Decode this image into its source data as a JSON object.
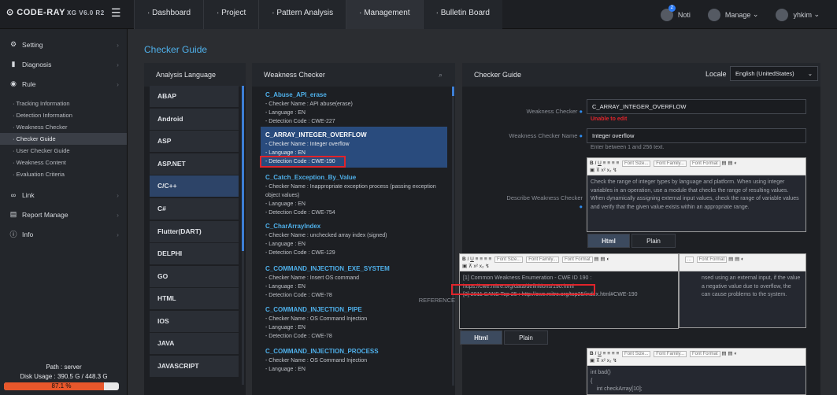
{
  "app": {
    "logo": "CODE-RAY",
    "version": "XG V6.0 R2"
  },
  "nav": {
    "items": [
      "Dashboard",
      "Project",
      "Pattern Analysis",
      "Management",
      "Bulletin Board"
    ],
    "notice": {
      "label": "Noti",
      "count": "2"
    },
    "manage": "Manage",
    "user": "yhkim"
  },
  "sidebar": {
    "items": [
      {
        "icon": "gear-icon",
        "label": "Setting"
      },
      {
        "icon": "bar-chart-icon",
        "label": "Diagnosis"
      },
      {
        "icon": "check-circle-icon",
        "label": "Rule"
      }
    ],
    "rule_subitems": [
      "Tracking Information",
      "Detection Information",
      "Weakness Checker",
      "Checker Guide",
      "User Checker Guide",
      "Weakness Content",
      "Evaluation Criteria"
    ],
    "items2": [
      {
        "icon": "link-icon",
        "label": "Link"
      },
      {
        "icon": "report-icon",
        "label": "Report Manage"
      },
      {
        "icon": "info-icon",
        "label": "Info"
      }
    ],
    "path": "Path : server",
    "disk": "Disk Usage : 390.5 G / 448.3 G",
    "disk_percent_label": "87.1 %",
    "disk_fraction": 0.871
  },
  "page_title": "Checker Guide",
  "lang_panel": {
    "title": "Analysis Language",
    "items": [
      "ABAP",
      "Android",
      "ASP",
      "ASP.NET",
      "C/C++",
      "C#",
      "Flutter(DART)",
      "DELPHI",
      "GO",
      "HTML",
      "IOS",
      "JAVA",
      "JAVASCRIPT"
    ]
  },
  "weak_panel": {
    "title": "Weakness Checker",
    "items": [
      {
        "name": "C_Abuse_API_erase",
        "l1": "- Checker Name : API abuse(erase)",
        "l2": "- Language : EN",
        "l3": "- Detection Code : CWE-227"
      },
      {
        "name": "C_ARRAY_INTEGER_OVERFLOW",
        "l1": "- Checker Name : Integer overflow",
        "l2": "- Language : EN",
        "l3": "- Detection Code : CWE-190"
      },
      {
        "name": "C_Catch_Exception_By_Value",
        "l1": "- Checker Name : Inappropriate exception process (passing exception object values)",
        "l2": "- Language : EN",
        "l3": "- Detection Code : CWE-754"
      },
      {
        "name": "C_CharArrayIndex",
        "l1": "- Checker Name : unchecked array index (signed)",
        "l2": "- Language : EN",
        "l3": "- Detection Code : CWE-129"
      },
      {
        "name": "C_COMMAND_INJECTION_EXE_SYSTEM",
        "l1": "- Checker Name : Insert OS command",
        "l2": "- Language : EN",
        "l3": "- Detection Code : CWE-78"
      },
      {
        "name": "C_COMMAND_INJECTION_PIPE",
        "l1": "- Checker Name : OS Command Injection",
        "l2": "- Language : EN",
        "l3": "- Detection Code : CWE-78"
      },
      {
        "name": "C_COMMAND_INJECTION_PROCESS",
        "l1": "- Checker Name : OS Command Injection",
        "l2": "- Language : EN",
        "l3": ""
      }
    ]
  },
  "guide_panel": {
    "title": "Checker Guide",
    "locale_label": "Locale",
    "locale_value": "English (UnitedStates)",
    "weakness_checker_label": "Weakness Checker",
    "weakness_checker_value": "C_ARRAY_INTEGER_OVERFLOW",
    "unable": "Unable to edit",
    "checker_name_label": "Weakness Checker Name",
    "checker_name_value": "Integer overflow",
    "checker_name_help": "Enter between 1 and 256 text.",
    "describe_label": "Describe Weakness Checker",
    "describe_text": "Check the range of integer types by language and platform. When using integer variables in an operation, use a module that checks the range of resulting values. When dynamically assigning external input values, check the range of variable values and verify that the given value exists within an appropriate range.",
    "reference_label": "REFERENCE",
    "reference_lines": [
      "[1] Common Weakness Enumeration - CWE ID 190 :",
      "https://cwe.mitre.org/data/definitions/190.html",
      "[2] 2011 SANS Top 25 : http://cwe.mitre.org/top25/index.html#CWE-190"
    ],
    "behind_text": [
      "nsed using an external input, if the value",
      "a negative value due to overflow, the",
      "can cause problems to the system."
    ],
    "code_lines": [
      "int bad()",
      "{",
      "    int checkArray[10];"
    ],
    "tab_html": "Html",
    "tab_plain": "Plain",
    "toolbar": {
      "font_size": "Font Size...",
      "font_family": "Font Family...",
      "font_format": "Font Format"
    }
  }
}
